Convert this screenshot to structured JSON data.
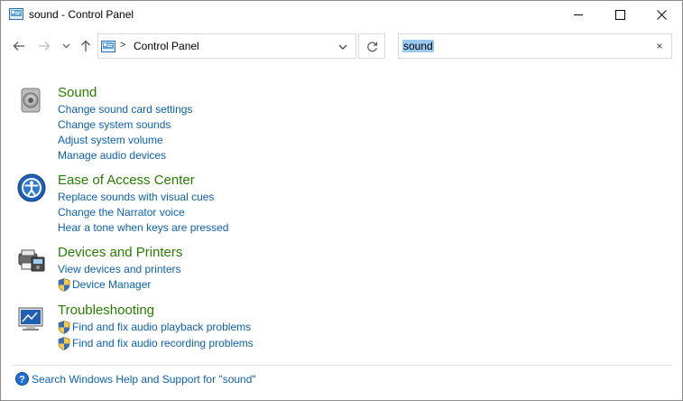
{
  "window": {
    "title": "sound - Control Panel"
  },
  "titlebar": {
    "minimize_icon": "minimize-icon",
    "maximize_icon": "maximize-icon",
    "close_icon": "close-icon"
  },
  "nav": {
    "back_icon": "arrow-left-icon",
    "forward_icon": "arrow-right-icon",
    "recent_icon": "chevron-down-icon",
    "up_icon": "arrow-up-icon"
  },
  "address": {
    "separator": ">",
    "location": "Control Panel"
  },
  "search": {
    "value": "sound",
    "clear_label": "×"
  },
  "groups": [
    {
      "icon": "speaker-icon",
      "title": "Sound",
      "tasks": [
        {
          "label": "Change sound card settings",
          "shield": false
        },
        {
          "label": "Change system sounds",
          "shield": false
        },
        {
          "label": "Adjust system volume",
          "shield": false
        },
        {
          "label": "Manage audio devices",
          "shield": false
        }
      ]
    },
    {
      "icon": "ease-of-access-icon",
      "title": "Ease of Access Center",
      "tasks": [
        {
          "label": "Replace sounds with visual cues",
          "shield": false
        },
        {
          "label": "Change the Narrator voice",
          "shield": false
        },
        {
          "label": "Hear a tone when keys are pressed",
          "shield": false
        }
      ]
    },
    {
      "icon": "devices-printers-icon",
      "title": "Devices and Printers",
      "tasks": [
        {
          "label": "View devices and printers",
          "shield": false
        },
        {
          "label": "Device Manager",
          "shield": true
        }
      ]
    },
    {
      "icon": "troubleshooting-icon",
      "title": "Troubleshooting",
      "tasks": [
        {
          "label": "Find and fix audio playback problems",
          "shield": true
        },
        {
          "label": "Find and fix audio recording problems",
          "shield": true
        }
      ]
    }
  ],
  "footer": {
    "help_text": "Search Windows Help and Support for \"sound\"",
    "help_icon": "help-icon"
  },
  "colors": {
    "group_title": "#267f00",
    "link": "#0b61b6",
    "selection": "#99c9ef"
  }
}
